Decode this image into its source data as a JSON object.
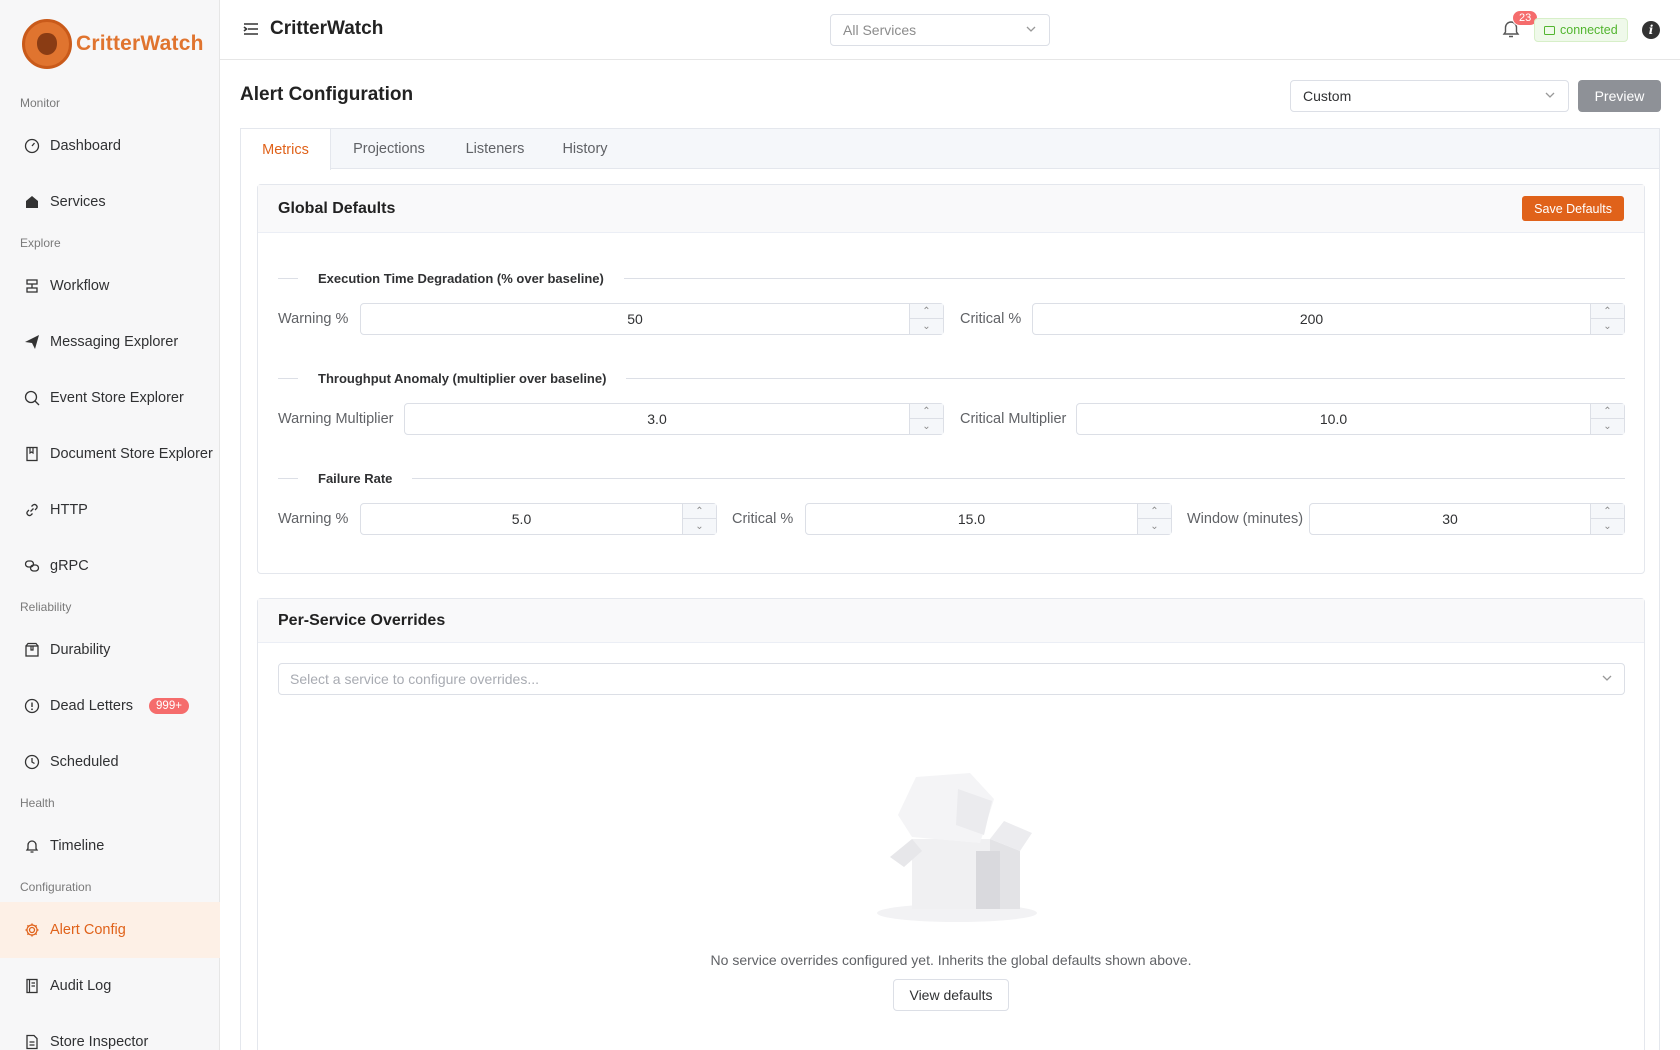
{
  "brand": {
    "name": "CritterWatch"
  },
  "topbar": {
    "title": "CritterWatch",
    "service_select": {
      "value": "All Services"
    },
    "notifications_count": "23",
    "connection_status": "connected"
  },
  "sidebar": {
    "sections": [
      {
        "label": "Monitor"
      },
      {
        "label": "Explore"
      },
      {
        "label": "Reliability"
      },
      {
        "label": "Health"
      },
      {
        "label": "Configuration"
      }
    ],
    "items": [
      {
        "label": "Dashboard",
        "icon": "gauge-icon"
      },
      {
        "label": "Services",
        "icon": "home-icon"
      },
      {
        "label": "Workflow",
        "icon": "workflow-icon"
      },
      {
        "label": "Messaging Explorer",
        "icon": "send-icon"
      },
      {
        "label": "Event Store Explorer",
        "icon": "search-icon"
      },
      {
        "label": "Document Store Explorer",
        "icon": "document-icon"
      },
      {
        "label": "HTTP",
        "icon": "link-icon"
      },
      {
        "label": "gRPC",
        "icon": "grpc-icon"
      },
      {
        "label": "Durability",
        "icon": "box-icon"
      },
      {
        "label": "Dead Letters",
        "icon": "warning-circle-icon",
        "badge": "999+"
      },
      {
        "label": "Scheduled",
        "icon": "clock-icon"
      },
      {
        "label": "Timeline",
        "icon": "bell-icon"
      },
      {
        "label": "Alert Config",
        "icon": "gear-icon",
        "active": true
      },
      {
        "label": "Audit Log",
        "icon": "notebook-icon"
      },
      {
        "label": "Store Inspector",
        "icon": "file-icon"
      }
    ]
  },
  "main": {
    "title": "Alert Configuration",
    "preset_select": {
      "value": "Custom"
    },
    "preview_label": "Preview",
    "tabs": [
      {
        "label": "Metrics",
        "active": true
      },
      {
        "label": "Projections"
      },
      {
        "label": "Listeners"
      },
      {
        "label": "History"
      }
    ],
    "global_defaults": {
      "title": "Global Defaults",
      "save_label": "Save Defaults",
      "execution_time": {
        "heading": "Execution Time Degradation (% over baseline)",
        "warning_label": "Warning %",
        "warning_value": "50",
        "critical_label": "Critical %",
        "critical_value": "200"
      },
      "throughput": {
        "heading": "Throughput Anomaly (multiplier over baseline)",
        "warning_label": "Warning Multiplier",
        "warning_value": "3.0",
        "critical_label": "Critical Multiplier",
        "critical_value": "10.0"
      },
      "failure_rate": {
        "heading": "Failure Rate",
        "warning_label": "Warning %",
        "warning_value": "5.0",
        "critical_label": "Critical %",
        "critical_value": "15.0",
        "window_label": "Window (minutes)",
        "window_value": "30"
      }
    },
    "overrides": {
      "title": "Per-Service Overrides",
      "select_placeholder": "Select a service to configure overrides...",
      "empty_text": "No service overrides configured yet. Inherits the global defaults shown above.",
      "view_defaults_label": "View defaults"
    }
  },
  "colors": {
    "accent": "#e0621a",
    "danger": "#f56c6c",
    "success": "#52b52f"
  }
}
